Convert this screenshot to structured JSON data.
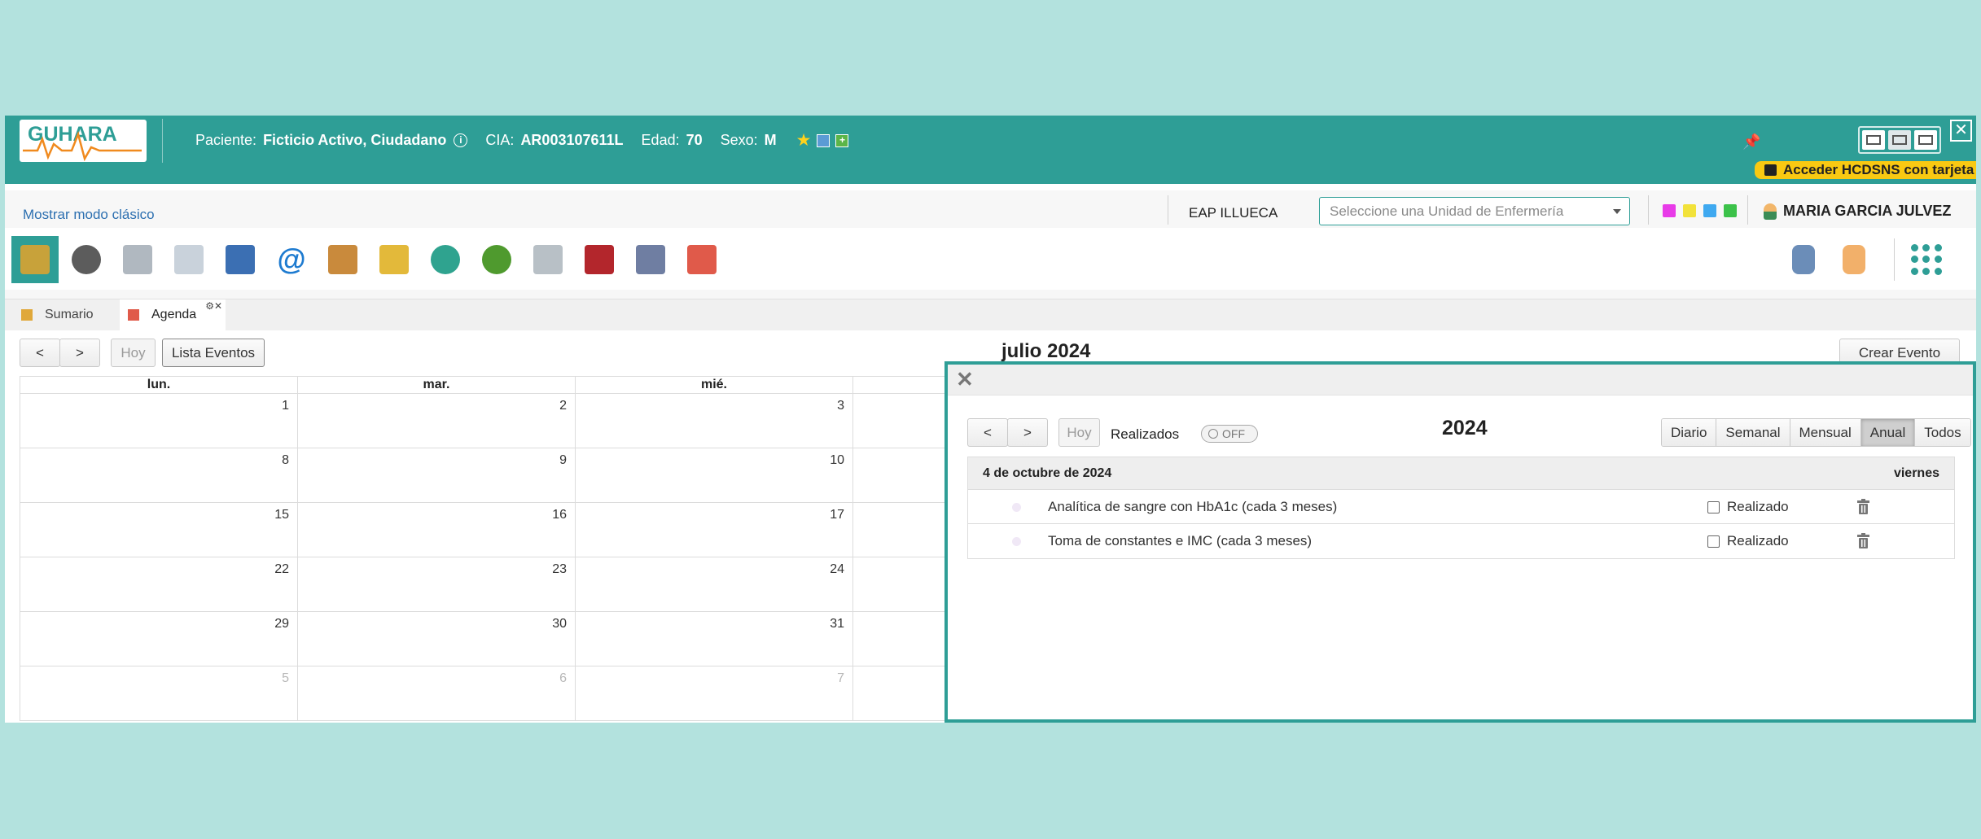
{
  "header": {
    "logo_text": "GUHARA",
    "patient_label": "Paciente:",
    "patient_name": "Ficticio Activo, Ciudadano",
    "info_glyph": "i",
    "cia_label": "CIA:",
    "cia_value": "AR003107611L",
    "age_label": "Edad:",
    "age_value": "70",
    "sex_label": "Sexo:",
    "sex_value": "M",
    "star_glyph": "★",
    "plus_glyph": "+",
    "hcd_button": "Acceder HCDSNS con tarjeta",
    "close_glyph": "✕",
    "pin_glyph": "📌"
  },
  "toolbar": {
    "classic_mode_link": "Mostrar modo clásico",
    "center_name": "EAP ILLUECA",
    "unit_select_placeholder": "Seleccione una Unidad de Enfermería",
    "user_name": "MARIA GARCIA JULVEZ",
    "at_glyph": "@",
    "note_colors": [
      "#e83be8",
      "#f2e23a",
      "#3fa9f0",
      "#3cc24a"
    ],
    "icons": [
      {
        "name": "library-icon",
        "color": "#c8a23a"
      },
      {
        "name": "scale-icon",
        "color": "#5c5c5c"
      },
      {
        "name": "pill-boxes-icon",
        "color": "#b0b8c0"
      },
      {
        "name": "lab-report-icon",
        "color": "#c9d2db"
      },
      {
        "name": "globe-document-icon",
        "color": "#3b6fb3"
      },
      {
        "name": "email-icon",
        "color": "#1e7bd0"
      },
      {
        "name": "clipboard-icon",
        "color": "#c98a3c"
      },
      {
        "name": "edit-document-icon",
        "color": "#e3b93a"
      },
      {
        "name": "vital-signs-icon",
        "color": "#2fa38f"
      },
      {
        "name": "virus-icon",
        "color": "#4f9a2e"
      },
      {
        "name": "syringe-icon",
        "color": "#b8c0c6"
      },
      {
        "name": "binders-icon",
        "color": "#b3262c"
      },
      {
        "name": "checklist-icon",
        "color": "#6f7ea2"
      },
      {
        "name": "calendar-icon",
        "color": "#e05a4a"
      }
    ],
    "right_icons": [
      {
        "name": "paperclip-icon",
        "color": "#6b8db8"
      },
      {
        "name": "pointing-hand-icon",
        "color": "#f2b06a"
      }
    ]
  },
  "tabs": [
    {
      "label": "Sumario",
      "color": "#e0a83a"
    },
    {
      "label": "Agenda",
      "color": "#e05a4a"
    }
  ],
  "tab_close_glyph": "⚙✕",
  "calendar": {
    "prev_glyph": "<",
    "next_glyph": ">",
    "today_button": "Hoy",
    "list_button": "Lista Eventos",
    "title": "julio 2024",
    "create_button": "Crear Evento",
    "weekdays": [
      "lun.",
      "mar.",
      "mié."
    ],
    "weeks": [
      [
        "1",
        "2",
        "3"
      ],
      [
        "8",
        "9",
        "10"
      ],
      [
        "15",
        "16",
        "17"
      ],
      [
        "22",
        "23",
        "24"
      ],
      [
        "29",
        "30",
        "31"
      ],
      [
        "5",
        "6",
        "7"
      ]
    ]
  },
  "events_panel": {
    "close_glyph": "✕",
    "prev_glyph": "<",
    "next_glyph": ">",
    "today_button": "Hoy",
    "realizados_label": "Realizados",
    "toggle_state": "OFF",
    "year_title": "2024",
    "views": [
      "Diario",
      "Semanal",
      "Mensual",
      "Anual",
      "Todos"
    ],
    "active_view": "Anual",
    "day_header_date": "4 de octubre de 2024",
    "day_header_weekday": "viernes",
    "events": [
      {
        "title": "Analítica de sangre con HbA1c (cada 3 meses)",
        "done_label": "Realizado",
        "done": false
      },
      {
        "title": "Toma de constantes e IMC (cada 3 meses)",
        "done_label": "Realizado",
        "done": false
      }
    ]
  },
  "colors": {
    "brand_teal": "#2e9e96",
    "page_background": "#b3e2de",
    "hcd_yellow": "#f9c912",
    "link_blue": "#2c6fb0"
  }
}
